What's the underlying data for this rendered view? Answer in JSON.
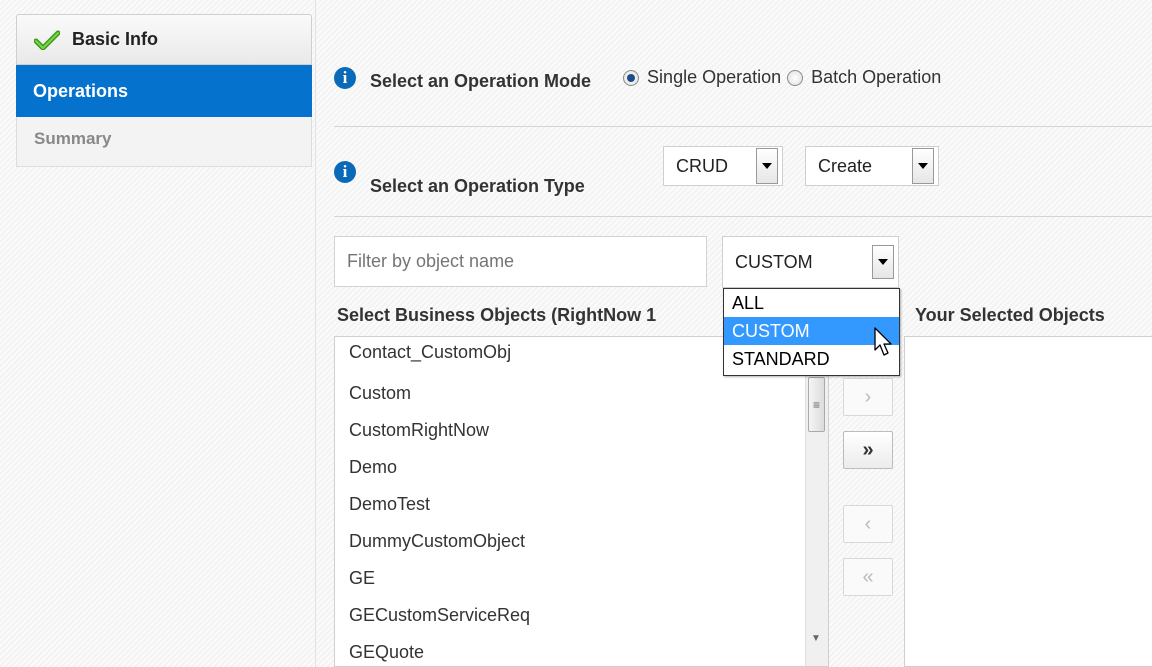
{
  "train": {
    "steps": [
      {
        "label": "Basic Info",
        "state": "done"
      },
      {
        "label": "Operations",
        "state": "active"
      },
      {
        "label": "Summary",
        "state": "future"
      }
    ]
  },
  "operation_mode": {
    "label": "Select an Operation Mode",
    "options": [
      "Single Operation",
      "Batch Operation"
    ],
    "selected": "Single Operation"
  },
  "operation_type": {
    "label": "Select an Operation Type",
    "type_value": "CRUD",
    "action_value": "Create"
  },
  "filter": {
    "placeholder": "Filter by object name",
    "category_value": "CUSTOM",
    "category_options": [
      "ALL",
      "CUSTOM",
      "STANDARD"
    ],
    "highlighted": "CUSTOM"
  },
  "business_objects": {
    "header": "Select Business Objects (RightNow 1",
    "items": [
      "Contact_CustomObj",
      "Custom",
      "CustomRightNow",
      "Demo",
      "DemoTest",
      "DummyCustomObject",
      "GE",
      "GECustomServiceReq",
      "GEQuote"
    ]
  },
  "selected_objects": {
    "header": "Your Selected Objects"
  },
  "shuttle": {
    "move": "›",
    "move_all": "»",
    "remove": "‹",
    "remove_all": "«"
  },
  "colors": {
    "accent": "#0572ce",
    "highlight": "#3399ff",
    "info_icon": "#0b6ab8"
  }
}
